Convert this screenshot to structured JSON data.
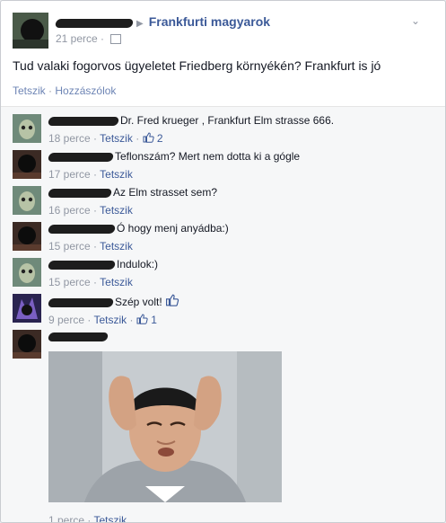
{
  "post": {
    "group": "Frankfurti magyarok",
    "time": "21 perce",
    "text": "Tud valaki fogorvos ügyeletet Friedberg környékén? Frankfurt is jó",
    "actions": {
      "like": "Tetszik",
      "separator": "·",
      "comment": "Hozzászólok"
    },
    "icons": {
      "audience": "audience-icon",
      "menu": "chevron-down-icon"
    }
  },
  "comments": [
    {
      "text": "Dr. Fred krueger , Frankfurt Elm strasse 666.",
      "time": "18 perce",
      "like_label": "Tetszik",
      "likes": "2"
    },
    {
      "text": "Teflonszám? Mert nem dotta ki a gógle",
      "time": "17 perce",
      "like_label": "Tetszik"
    },
    {
      "text": "Az Elm strasset sem?",
      "time": "16 perce",
      "like_label": "Tetszik"
    },
    {
      "text": "Ó hogy menj anyádba:)",
      "time": "15 perce",
      "like_label": "Tetszik"
    },
    {
      "text": "Indulok:)",
      "time": "15 perce",
      "like_label": "Tetszik"
    },
    {
      "text": "Szép volt!",
      "time": "9 perce",
      "like_label": "Tetszik",
      "likes": "1"
    },
    {
      "text": "",
      "time": "1 perce",
      "like_label": "Tetszik"
    }
  ],
  "colors": {
    "link": "#3b5998",
    "meta": "#9197a3",
    "background": "#e9eaed",
    "comments_bg": "#f6f7f8"
  }
}
